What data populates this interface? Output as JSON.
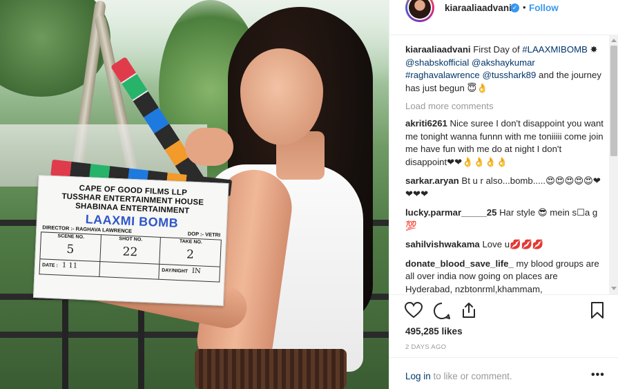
{
  "photo": {
    "board_lines": [
      "CAPE OF GOOD FILMS LLP",
      "TUSSHAR ENTERTAINMENT HOUSE",
      "SHABINAA ENTERTAINMENT"
    ],
    "board_title": "LAAXMI BOMB",
    "director_label": "DIRECTOR :- RAGHAVA LAWRENCE",
    "dop_label": "DOP :- VETRI",
    "cells": [
      {
        "label": "SCENE NO.",
        "value": "5"
      },
      {
        "label": "SHOT NO.",
        "value": "22"
      },
      {
        "label": "TAKE NO.",
        "value": "2"
      }
    ],
    "foot": {
      "date_label": "DATE :",
      "date_value": "1 11",
      "daynight_label": "DAY/NIGHT",
      "daynight_value": "IN"
    }
  },
  "header": {
    "username": "kiaraaliaadvani",
    "dot": "•",
    "follow_label": "Follow"
  },
  "caption": {
    "username": "kiaraaliaadvani",
    "text_before": "First Day of ",
    "hashtag1": "#LAAXMIBOMB",
    "emoji1": "✸ ",
    "mention1": "@shabskofficial",
    "mention2": "@akshaykumar",
    "hashtag2": "#raghavalawrence",
    "mention3": "@tusshark89",
    "text_after": " and the journey has just begun 😇👌"
  },
  "load_more": "Load more comments",
  "comments": [
    {
      "user": "akriti6261",
      "text": "Nice suree I don't disappoint you want me tonight wanna funnn with me toniiiii come join me have fun with me do at night I don't disappoint❤❤👌👌👌👌"
    },
    {
      "user": "sarkar.aryan",
      "text": "Bt u r also...bomb.....😍😍😍😍😍❤❤❤❤"
    },
    {
      "user": "lucky.parmar_____25",
      "text": "Har style 😎 mein s☐a g 💯"
    },
    {
      "user": "sahilvishwakama",
      "text": "Love u💋💋💋"
    },
    {
      "user": "donate_blood_save_life_",
      "text": "my blood groups are all over india now going on places are Hyderabad, nzbtonrml,khammam, Godavarikhani.kamareddv.west Godavari lo"
    }
  ],
  "stats": {
    "likes": "495,285 likes",
    "time_ago": "2 DAYS AGO"
  },
  "footer": {
    "login_link": "Log in",
    "login_text": " to like or comment.",
    "more": "•••"
  },
  "colors": {
    "accent": "#3897f0",
    "link": "#003569",
    "muted": "#999999"
  },
  "icons": [
    "heart-icon",
    "comment-icon",
    "share-icon",
    "bookmark-icon",
    "verified-icon",
    "more-icon"
  ]
}
